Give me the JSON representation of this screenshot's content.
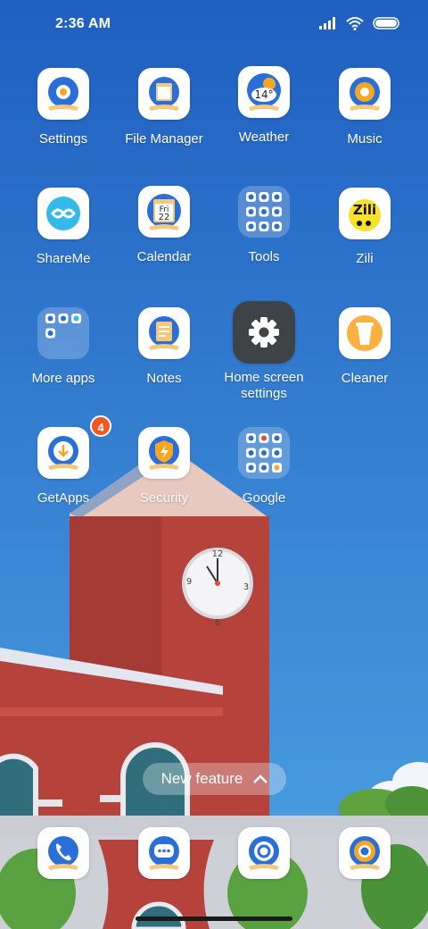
{
  "status_bar": {
    "time": "2:36 AM",
    "icons": [
      "signal-icon",
      "wifi-icon",
      "battery-icon"
    ]
  },
  "apps": [
    {
      "label": "Settings",
      "icon": "settings-icon"
    },
    {
      "label": "File Manager",
      "icon": "file-manager-icon"
    },
    {
      "label": "Weather",
      "icon": "weather-icon",
      "icon_text": "14°"
    },
    {
      "label": "Music",
      "icon": "music-icon"
    },
    {
      "label": "ShareMe",
      "icon": "shareme-icon"
    },
    {
      "label": "Calendar",
      "icon": "calendar-icon",
      "icon_day": "Fri",
      "icon_date": "22"
    },
    {
      "label": "Tools",
      "icon": "folder-icon"
    },
    {
      "label": "Zili",
      "icon": "zili-icon",
      "icon_text": "Zili"
    },
    {
      "label": "More apps",
      "icon": "folder-icon"
    },
    {
      "label": "Notes",
      "icon": "notes-icon"
    },
    {
      "label": "Home screen settings",
      "icon": "gear-icon"
    },
    {
      "label": "Cleaner",
      "icon": "cleaner-icon"
    },
    {
      "label": "GetApps",
      "icon": "getapps-icon",
      "badge": "4"
    },
    {
      "label": "Security",
      "icon": "security-icon"
    },
    {
      "label": "Google",
      "icon": "folder-icon"
    }
  ],
  "new_feature": {
    "label": "New feature",
    "icon": "chevron-up-icon"
  },
  "dock": [
    {
      "name": "phone",
      "icon": "phone-icon"
    },
    {
      "name": "messaging",
      "icon": "message-icon"
    },
    {
      "name": "browser",
      "icon": "browser-icon"
    },
    {
      "name": "chrome",
      "icon": "chrome-icon"
    }
  ],
  "wallpaper": {
    "sky_top": "#1f5fc0",
    "sky_bottom": "#4a9ee0",
    "tower_color": "#b5433c",
    "clock_numbers": [
      "12",
      "3",
      "6",
      "9"
    ]
  },
  "colors": {
    "icon_blue": "#2a6fd8",
    "icon_orange": "#f5a623",
    "badge": "#f0581f"
  }
}
